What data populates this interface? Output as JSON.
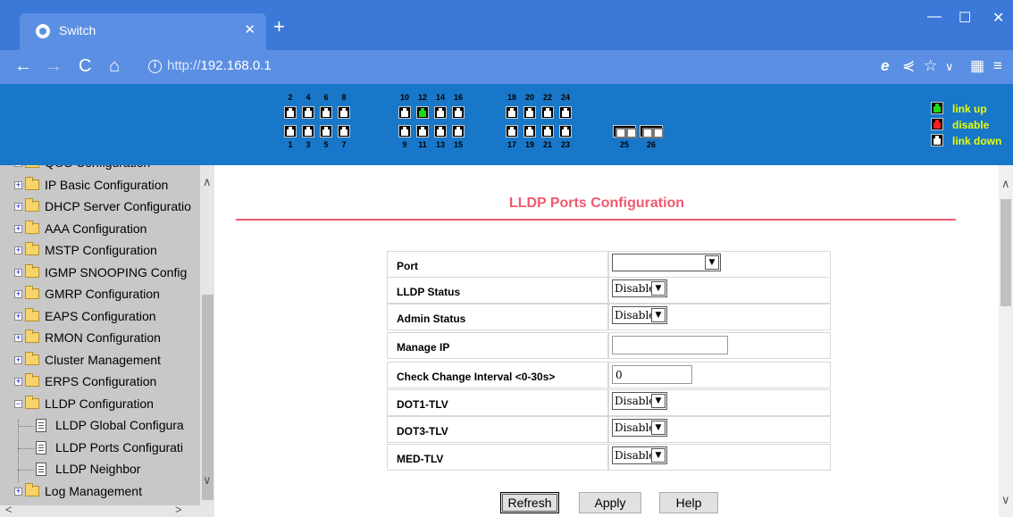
{
  "browser": {
    "tab_title": "Switch",
    "url_scheme": "http://",
    "url_host": "192.168.0.1"
  },
  "banner": {
    "top_port_numbers": [
      "2",
      "4",
      "6",
      "8",
      "10",
      "12",
      "14",
      "16",
      "18",
      "20",
      "22",
      "24"
    ],
    "bottom_port_numbers": [
      "1",
      "3",
      "5",
      "7",
      "9",
      "11",
      "13",
      "15",
      "17",
      "19",
      "21",
      "23"
    ],
    "fiber_port_numbers": [
      "25",
      "26"
    ],
    "link_up_port": "12",
    "legend": {
      "link_up": "link up",
      "disable": "disable",
      "link_down": "link down"
    },
    "colors": {
      "link_up": "#1bdc12",
      "disable": "#ff2020",
      "link_down": "#ffffff",
      "legend_text": "#e8ff00"
    }
  },
  "sidebar": {
    "items": [
      {
        "label": "QOS Configuration",
        "type": "folder"
      },
      {
        "label": "IP Basic Configuration",
        "type": "folder"
      },
      {
        "label": "DHCP Server Configuratio",
        "type": "folder"
      },
      {
        "label": "AAA Configuration",
        "type": "folder"
      },
      {
        "label": "MSTP Configuration",
        "type": "folder"
      },
      {
        "label": "IGMP SNOOPING Config",
        "type": "folder"
      },
      {
        "label": "GMRP Configuration",
        "type": "folder"
      },
      {
        "label": "EAPS Configuration",
        "type": "folder"
      },
      {
        "label": "RMON Configuration",
        "type": "folder"
      },
      {
        "label": "Cluster Management",
        "type": "folder"
      },
      {
        "label": "ERPS Configuration",
        "type": "folder"
      },
      {
        "label": "LLDP Configuration",
        "type": "folder-open"
      },
      {
        "label": "LLDP Global Configura",
        "type": "page"
      },
      {
        "label": "LLDP Ports Configurati",
        "type": "page"
      },
      {
        "label": "LLDP Neighbor",
        "type": "page"
      },
      {
        "label": "Log Management",
        "type": "folder"
      }
    ]
  },
  "main": {
    "title": "LLDP Ports Configuration",
    "fields": [
      {
        "label": "Port",
        "kind": "select",
        "value": ""
      },
      {
        "label": "LLDP Status",
        "kind": "select",
        "value": "Disable"
      },
      {
        "label": "Admin Status",
        "kind": "select",
        "value": "Disable"
      },
      {
        "label": "Manage IP",
        "kind": "text",
        "value": ""
      },
      {
        "label": "Check Change Interval <0-30s>",
        "kind": "text",
        "value": "0"
      },
      {
        "label": "DOT1-TLV",
        "kind": "select",
        "value": "Disable"
      },
      {
        "label": "DOT3-TLV",
        "kind": "select",
        "value": "Disable"
      },
      {
        "label": "MED-TLV",
        "kind": "select",
        "value": "Disable"
      }
    ],
    "buttons": {
      "refresh": "Refresh",
      "apply": "Apply",
      "help": "Help"
    },
    "title_color": "#f05a6e"
  }
}
